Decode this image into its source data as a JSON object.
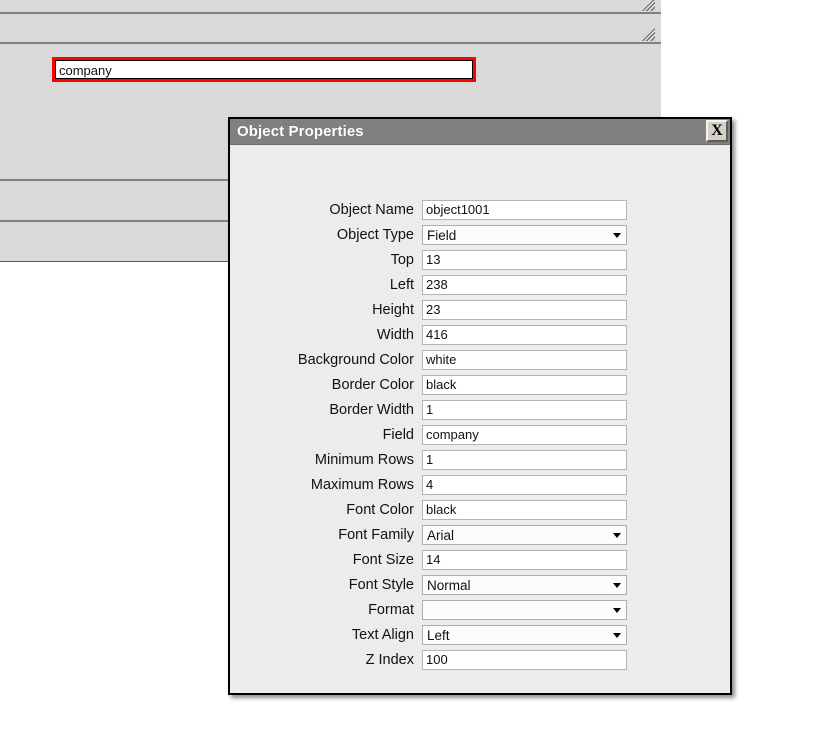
{
  "canvas": {
    "selected_field": {
      "value": "company",
      "border_color": "#ff0000",
      "inner_border_color": "#000000",
      "background": "#ffffff"
    },
    "band_color": "#d9d9d9",
    "divider_color": "#808080",
    "resize_handle_icon": "resize-handle-icon"
  },
  "dialog": {
    "title": "Object Properties",
    "close_label": "X",
    "titlebar_color": "#808080",
    "body_color": "#ececec",
    "rows": [
      {
        "label": "Object Name",
        "type": "text",
        "value": "object1001"
      },
      {
        "label": "Object Type",
        "type": "select",
        "value": "Field"
      },
      {
        "label": "Top",
        "type": "text",
        "value": "13"
      },
      {
        "label": "Left",
        "type": "text",
        "value": "238"
      },
      {
        "label": "Height",
        "type": "text",
        "value": "23"
      },
      {
        "label": "Width",
        "type": "text",
        "value": "416"
      },
      {
        "label": "Background Color",
        "type": "text",
        "value": "white"
      },
      {
        "label": "Border Color",
        "type": "text",
        "value": "black"
      },
      {
        "label": "Border Width",
        "type": "text",
        "value": "1"
      },
      {
        "label": "Field",
        "type": "text",
        "value": "company"
      },
      {
        "label": "Minimum Rows",
        "type": "text",
        "value": "1"
      },
      {
        "label": "Maximum Rows",
        "type": "text",
        "value": "4"
      },
      {
        "label": "Font Color",
        "type": "text",
        "value": "black"
      },
      {
        "label": "Font Family",
        "type": "select",
        "value": "Arial"
      },
      {
        "label": "Font Size",
        "type": "text",
        "value": "14"
      },
      {
        "label": "Font Style",
        "type": "select",
        "value": "Normal"
      },
      {
        "label": "Format",
        "type": "select",
        "value": ""
      },
      {
        "label": "Text Align",
        "type": "select",
        "value": "Left"
      },
      {
        "label": "Z Index",
        "type": "text",
        "value": "100"
      }
    ]
  }
}
